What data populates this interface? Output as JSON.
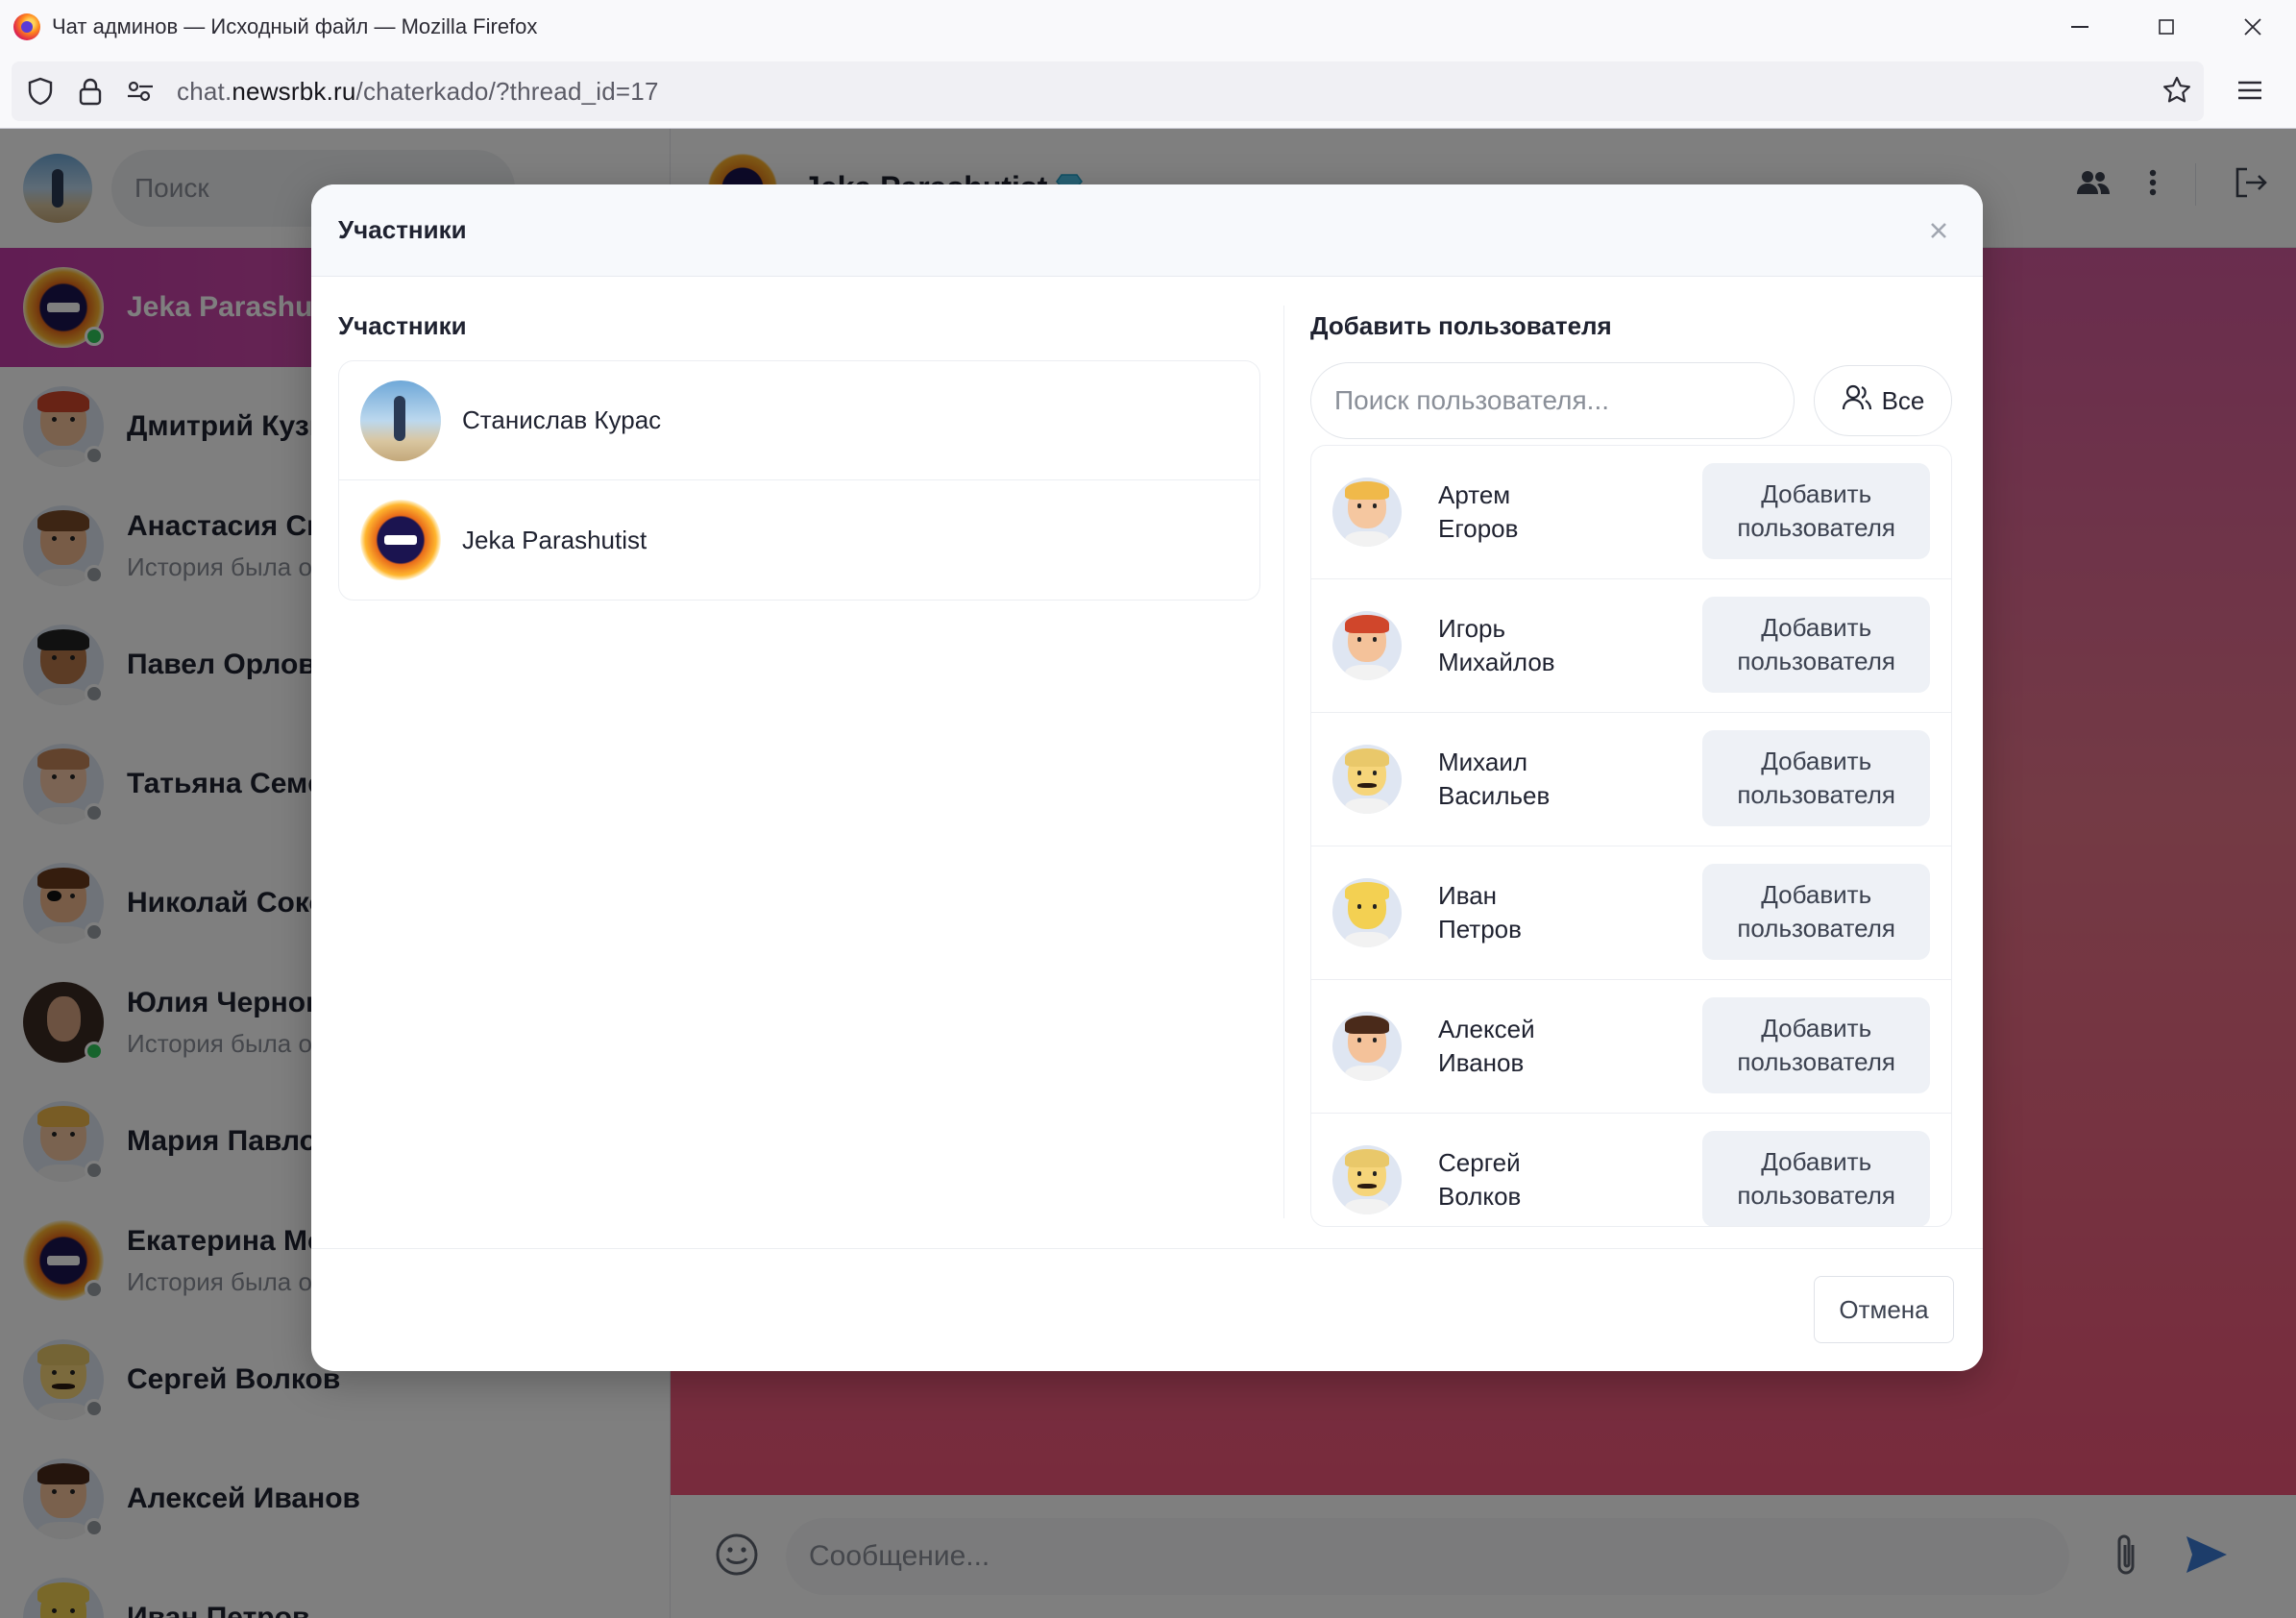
{
  "window": {
    "title": "Чат админов — Исходный файл — Mozilla Firefox",
    "controls": {
      "minimize": "—",
      "maximize": "☐",
      "close": "✕"
    }
  },
  "browser": {
    "url_prefix": "chat.",
    "url_domain": "newsrbk.ru",
    "url_path": "/chaterkado/?thread_id=17"
  },
  "sidebar": {
    "search_placeholder": "Поиск",
    "chats": [
      {
        "name": "Jeka Parashutist",
        "subtitle": "",
        "online": true,
        "active": true,
        "avatar": "wax-logo"
      },
      {
        "name": "Дмитрий Кузнецов",
        "subtitle": "",
        "online": false,
        "active": false,
        "avatar": "toon-redhair"
      },
      {
        "name": "Анастасия Смирнова",
        "subtitle": "История была очищена",
        "online": false,
        "active": false,
        "avatar": "toon-brown"
      },
      {
        "name": "Павел Орлов",
        "subtitle": "",
        "online": false,
        "active": false,
        "avatar": "toon-dark"
      },
      {
        "name": "Татьяна Семенова",
        "subtitle": "",
        "online": false,
        "active": false,
        "avatar": "toon-light"
      },
      {
        "name": "Николай Соколов",
        "subtitle": "",
        "online": false,
        "active": false,
        "avatar": "toon-pirate"
      },
      {
        "name": "Юлия Черногорова",
        "subtitle": "История была очищена",
        "online": true,
        "active": false,
        "avatar": "photo-woman"
      },
      {
        "name": "Мария Павлова",
        "subtitle": "",
        "online": false,
        "active": false,
        "avatar": "toon-blond"
      },
      {
        "name": "Екатерина Морозова",
        "subtitle": "История была очищена",
        "online": false,
        "active": false,
        "avatar": "wax-logo-small"
      },
      {
        "name": "Сергей Волков",
        "subtitle": "",
        "online": false,
        "active": false,
        "avatar": "toon-mustache"
      },
      {
        "name": "Алексей Иванов",
        "subtitle": "",
        "online": false,
        "active": false,
        "avatar": "toon-woman"
      },
      {
        "name": "Иван Петров",
        "subtitle": "",
        "online": false,
        "active": false,
        "avatar": "toon-yellow"
      }
    ]
  },
  "chat": {
    "title": "Jeka Parashutist",
    "message_placeholder": "Сообщение..."
  },
  "modal": {
    "title": "Участники",
    "members_title": "Участники",
    "members": [
      {
        "name": "Станислав Курас",
        "avatar": "photo-beach"
      },
      {
        "name": "Jeka Parashutist",
        "avatar": "wax-logo"
      }
    ],
    "add_title": "Добавить пользователя",
    "search_placeholder": "Поиск пользователя...",
    "all_label": "Все",
    "candidates": [
      {
        "first": "Артем",
        "last": "Егоров",
        "button_l1": "Добавить",
        "button_l2": "пользователя",
        "avatar": "toon-blond"
      },
      {
        "first": "Игорь",
        "last": "Михайлов",
        "button_l1": "Добавить",
        "button_l2": "пользователя",
        "avatar": "toon-redhair"
      },
      {
        "first": "Михаил",
        "last": "Васильев",
        "button_l1": "Добавить",
        "button_l2": "пользователя",
        "avatar": "toon-mustache"
      },
      {
        "first": "Иван",
        "last": "Петров",
        "button_l1": "Добавить",
        "button_l2": "пользователя",
        "avatar": "toon-yellow"
      },
      {
        "first": "Алексей",
        "last": "Иванов",
        "button_l1": "Добавить",
        "button_l2": "пользователя",
        "avatar": "toon-woman"
      },
      {
        "first": "Сергей",
        "last": "Волков",
        "button_l1": "Добавить",
        "button_l2": "пользователя",
        "avatar": "toon-mustache"
      }
    ],
    "cancel_label": "Отмена",
    "close_icon": "close-icon"
  },
  "colors": {
    "active_chat": "#c23aa6",
    "wallpaper_top": "#d35a9c",
    "wallpaper_bottom": "#f0567a",
    "online": "#2ec95a",
    "send": "#3a7bd5"
  }
}
